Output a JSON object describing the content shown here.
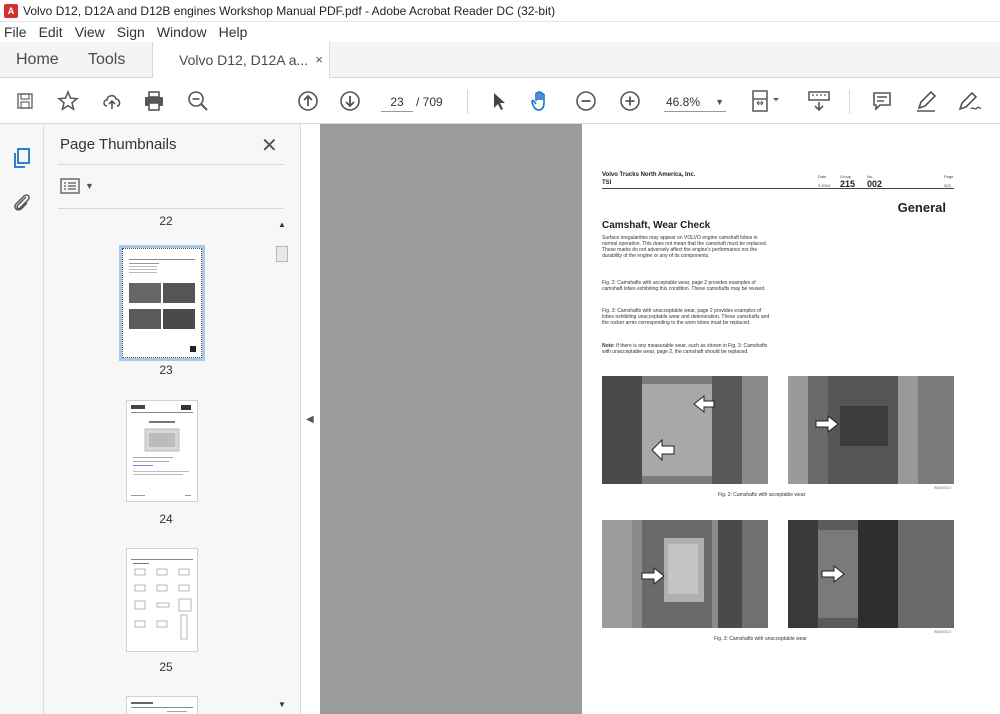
{
  "window": {
    "title": "Volvo D12, D12A and D12B engines Workshop Manual PDF.pdf - Adobe Acrobat Reader DC (32-bit)",
    "app_icon": "acrobat-icon"
  },
  "menu": [
    "File",
    "Edit",
    "View",
    "Sign",
    "Window",
    "Help"
  ],
  "tabs": {
    "home": "Home",
    "tools": "Tools",
    "doc": "Volvo D12, D12A a...",
    "close": "×"
  },
  "toolbar": {
    "page_current": "23",
    "page_total": "/ 709",
    "zoom": "46.8%"
  },
  "sidebar": {
    "title": "Page Thumbnails",
    "close": "✕"
  },
  "thumbnails": [
    {
      "label": "22"
    },
    {
      "label": "23",
      "selected": true
    },
    {
      "label": "24"
    },
    {
      "label": "25"
    }
  ],
  "document": {
    "company": "Volvo Trucks North America, Inc.",
    "tsi": "TSI",
    "hdr_date_label": "Date",
    "hdr_group_label": "Group",
    "hdr_no_label": "No.",
    "hdr_page_label": "Page",
    "hdr_date": "3.2004",
    "hdr_group": "215",
    "hdr_no": "002",
    "hdr_page": "2(2)",
    "section": "General",
    "heading": "Camshaft, Wear Check",
    "para1": "Surface irregularities may appear on VOLVO engine camshaft lobes in normal operation. This does not mean that the camshaft must be replaced. These marks do not adversely affect the engine's performance nor the durability of the engine or any of its components.",
    "para2": "Fig. 2: Camshafts with acceptable wear, page 2 provides examples of camshaft lobes exhibiting this condition. These camshafts may be reused.",
    "para3": "Fig. 3: Camshafts with unacceptable wear, page 2 provides examples of lobes exhibiting unacceptable wear and deterioration. These camshafts and the rocker arms corresponding to the worn lobes must be replaced.",
    "note_label": "Note:",
    "note": " If there is any measurable wear, such as shown in Fig. 3: Camshafts with unacceptable wear, page 2, the camshaft should be replaced.",
    "fig2_caption": "Fig. 2: Camshafts with acceptable wear",
    "fig3_caption": "Fig. 3: Camshafts with unacceptable wear",
    "fig2_code": "W2000314",
    "fig3_code": "W2000313"
  },
  "colors": {
    "selection": "#a9c8e6",
    "doc_bg": "#9b9b9b",
    "accent_red": "#d32f2f"
  }
}
